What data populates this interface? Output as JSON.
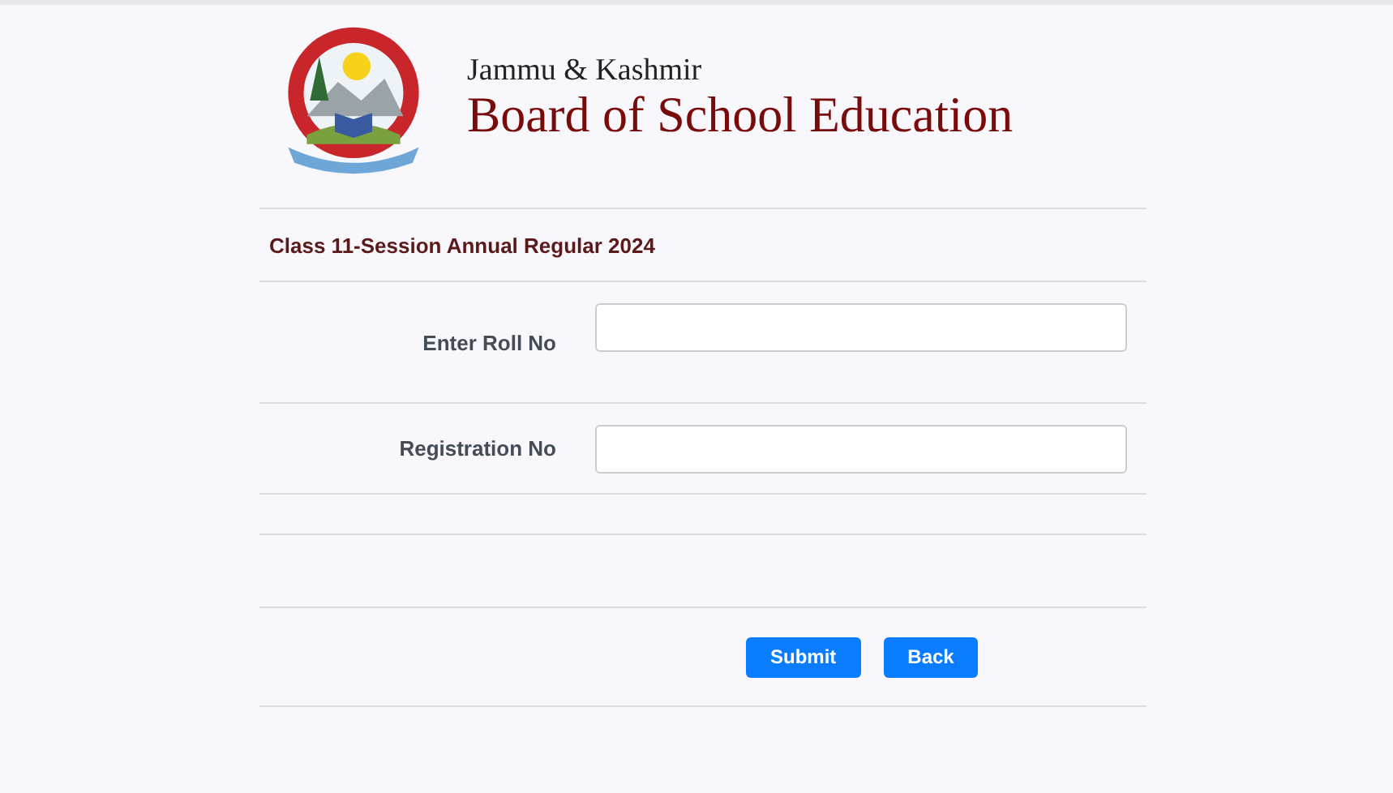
{
  "header": {
    "subtitle": "Jammu & Kashmir",
    "title": "Board of School Education"
  },
  "form": {
    "heading": "Class 11-Session Annual Regular 2024",
    "fields": [
      {
        "label": "Enter Roll No"
      },
      {
        "label": "Registration No"
      }
    ],
    "buttons": [
      "Submit",
      "Back"
    ]
  }
}
